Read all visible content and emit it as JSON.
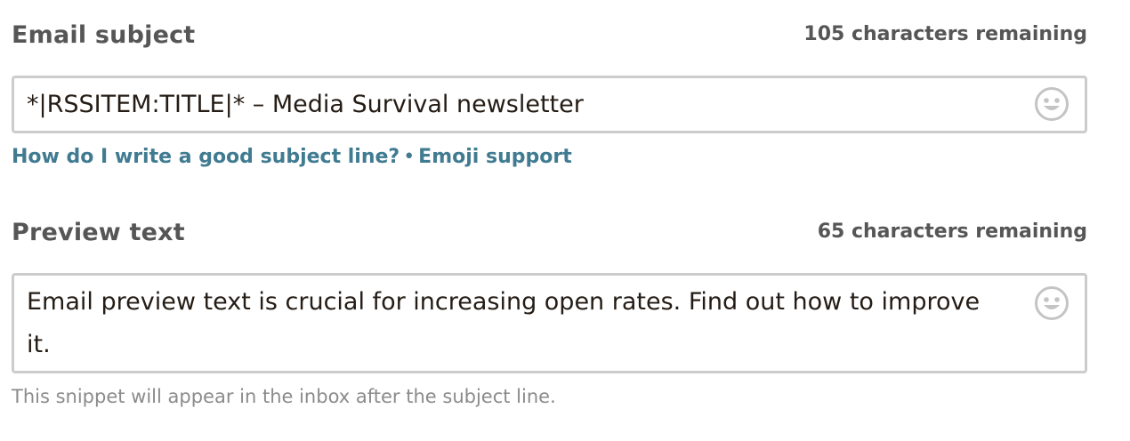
{
  "subject": {
    "label": "Email subject",
    "counter": "105 characters remaining",
    "value": "*|RSSITEM:TITLE|* – Media Survival newsletter",
    "emoji_icon": "smiley-icon",
    "links": {
      "good_subject": "How do I write a good subject line?",
      "separator": "•",
      "emoji_support": "Emoji support"
    }
  },
  "preview": {
    "label": "Preview text",
    "counter": "65 characters remaining",
    "value": "Email preview text is crucial for increasing open rates. Find out how to improve it.",
    "emoji_icon": "smiley-icon",
    "hint": "This snippet will appear in the inbox after the subject line."
  },
  "colors": {
    "label": "#565656",
    "link": "#407b91",
    "border": "#cccccc",
    "hint": "#8b8b8b",
    "text": "#241c15"
  }
}
